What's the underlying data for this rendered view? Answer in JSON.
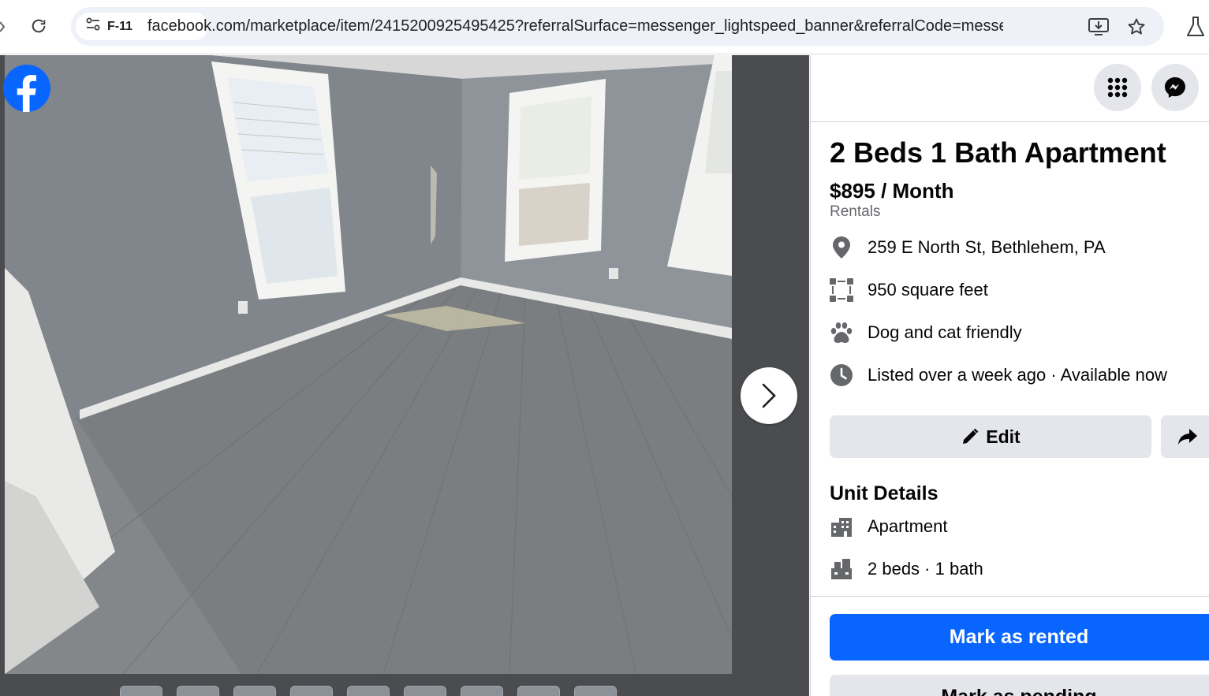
{
  "browser": {
    "site_chip_label": "F-11",
    "url": "facebook.com/marketplace/item/2415200925495425?referralSurface=messenger_lightspeed_banner&referralCode=messeng..."
  },
  "listing": {
    "title": "2 Beds 1 Bath Apartment",
    "price": "$895 / Month",
    "category": "Rentals",
    "details": [
      {
        "icon": "location-pin-icon",
        "text": "259 E North St, Bethlehem, PA"
      },
      {
        "icon": "square-feet-icon",
        "text": "950 square feet"
      },
      {
        "icon": "paw-icon",
        "text": "Dog and cat friendly"
      },
      {
        "icon": "clock-icon",
        "text": "Listed over a week ago · Available now"
      }
    ],
    "edit_label": "Edit",
    "unit_details_title": "Unit Details",
    "unit_details": [
      {
        "icon": "building-icon",
        "text": "Apartment"
      },
      {
        "icon": "bed-bath-icon",
        "text": "2 beds · 1 bath"
      }
    ],
    "mark_rented_label": "Mark as rented",
    "secondary_label": "Mark as pending"
  },
  "colors": {
    "facebook_blue": "#0866ff",
    "button_gray": "#e4e6eb",
    "secondary_text": "#65676b"
  }
}
